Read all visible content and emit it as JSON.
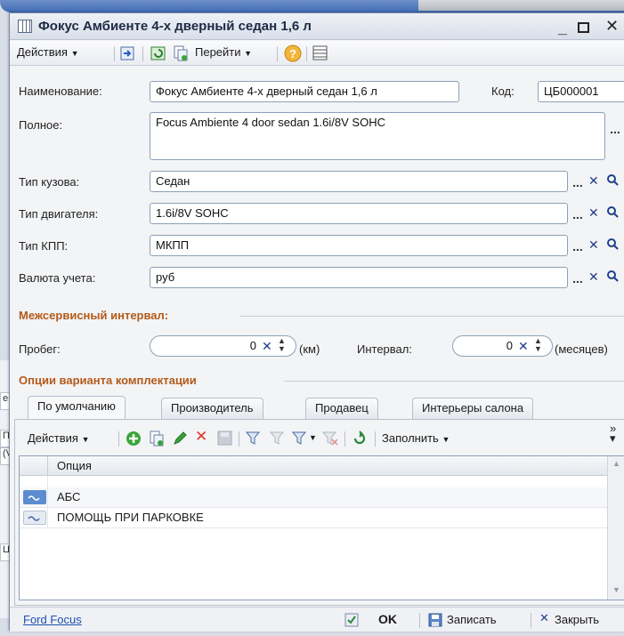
{
  "window": {
    "title": "Фокус Амбиенте 4-х дверный седан 1,6 л"
  },
  "toolbar": {
    "actions_label": "Действия",
    "goto_label": "Перейти"
  },
  "form": {
    "name_label": "Наименование:",
    "name_value": "Фокус Амбиенте 4-х дверный седан 1,6 л",
    "code_label": "Код:",
    "code_value": "ЦБ000001",
    "full_label": "Полное:",
    "full_value": "Focus Ambiente 4 door sedan 1.6i/8V SOHC",
    "body_label": "Тип кузова:",
    "body_value": "Седан",
    "engine_label": "Тип двигателя:",
    "engine_value": "1.6i/8V SOHC",
    "gearbox_label": "Тип КПП:",
    "gearbox_value": "МКПП",
    "currency_label": "Валюта учета:",
    "currency_value": "руб"
  },
  "service": {
    "section_title": "Межсервисный интервал:",
    "mileage_label": "Пробег:",
    "mileage_value": "0",
    "mileage_unit": "(км)",
    "interval_label": "Интервал:",
    "interval_value": "0",
    "interval_unit": "(месяцев)"
  },
  "options": {
    "section_title": "Опции варианта комплектации",
    "tabs": [
      {
        "label": "По умолчанию"
      },
      {
        "label": "Производитель"
      },
      {
        "label": "Продавец"
      },
      {
        "label": "Интерьеры салона"
      }
    ],
    "actions_label": "Действия",
    "fill_label": "Заполнить",
    "column_header": "Опция",
    "rows": [
      {
        "label": "АБС"
      },
      {
        "label": "ПОМОЩЬ ПРИ ПАРКОВКЕ"
      }
    ]
  },
  "footer": {
    "link_label": "Ford Focus",
    "ok_label": "OK",
    "save_label": "Записать",
    "close_label": "Закрыть"
  },
  "background_window": {
    "cells": [
      "e",
      "ПД",
      "(VI",
      "Ц"
    ]
  },
  "colors": {
    "section_title": "#b35a1a",
    "link": "#1d4fb3",
    "clear_x": "#1f3f8a",
    "delete_x": "#e0332a",
    "add_green": "#3aa53a"
  }
}
